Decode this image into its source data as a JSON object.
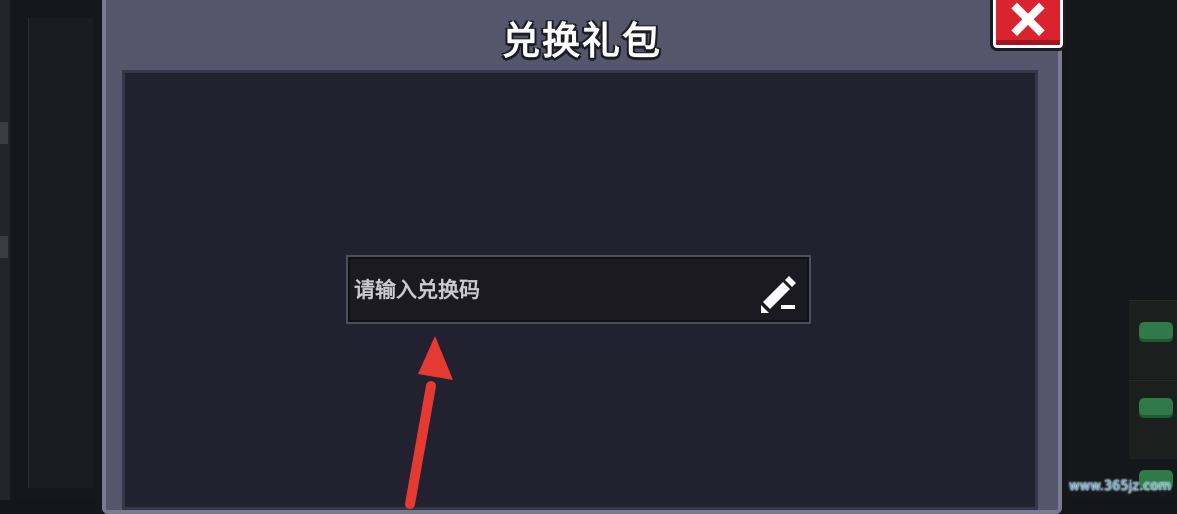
{
  "dialog": {
    "title": "兑换礼包",
    "close_icon": "close-x-icon"
  },
  "redeem": {
    "placeholder": "请输入兑换码",
    "value": "",
    "edit_icon": "pencil-icon"
  },
  "annotation": {
    "arrow_icon": "red-arrow-icon",
    "color": "#e53a31"
  },
  "watermark": {
    "text": "www.365jz.com"
  },
  "colors": {
    "dialog_frame": "#55566c",
    "content_bg": "#222130",
    "close_red": "#d9232e"
  }
}
